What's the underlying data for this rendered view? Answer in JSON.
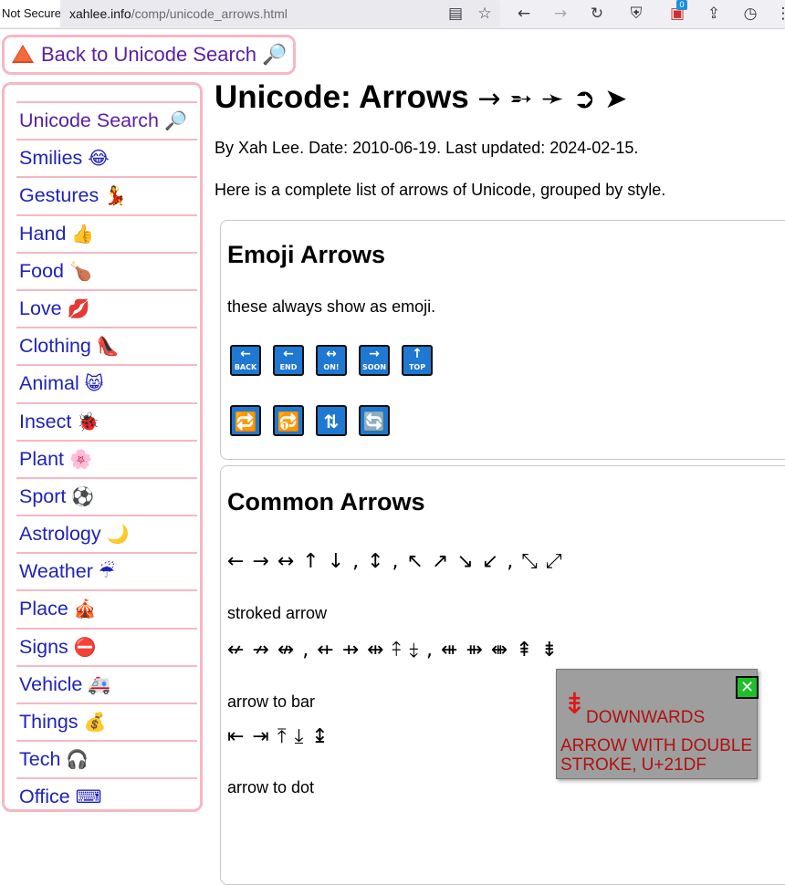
{
  "browser": {
    "security": "Not Secure",
    "url_host": "xahlee.info",
    "url_path": "/comp/unicode_arrows.html",
    "extension_badge": "0"
  },
  "back_button": {
    "label": "Back to Unicode Search"
  },
  "sidebar": {
    "items": [
      {
        "label": "Unicode Search",
        "icon": "🔎",
        "icon_name": "magnifier-icon"
      },
      {
        "label": "Smilies",
        "icon": "😂",
        "icon_name": "smiley-icon"
      },
      {
        "label": "Gestures",
        "icon": "💃",
        "icon_name": "dancer-icon"
      },
      {
        "label": "Hand",
        "icon": "👍",
        "icon_name": "thumbs-up-icon"
      },
      {
        "label": "Food",
        "icon": "🍗",
        "icon_name": "drumstick-icon"
      },
      {
        "label": "Love",
        "icon": "💋",
        "icon_name": "kiss-icon"
      },
      {
        "label": "Clothing",
        "icon": "👠",
        "icon_name": "high-heel-icon"
      },
      {
        "label": "Animal",
        "icon": "😸",
        "icon_name": "cat-icon"
      },
      {
        "label": "Insect",
        "icon": "🐞",
        "icon_name": "ladybug-icon"
      },
      {
        "label": "Plant",
        "icon": "🌸",
        "icon_name": "blossom-icon"
      },
      {
        "label": "Sport",
        "icon": "⚽",
        "icon_name": "soccer-ball-icon"
      },
      {
        "label": "Astrology",
        "icon": "🌙",
        "icon_name": "moon-icon"
      },
      {
        "label": "Weather",
        "icon": "☔",
        "icon_name": "umbrella-icon"
      },
      {
        "label": "Place",
        "icon": "🎪",
        "icon_name": "circus-tent-icon"
      },
      {
        "label": "Signs",
        "icon": "⛔",
        "icon_name": "no-entry-icon"
      },
      {
        "label": "Vehicle",
        "icon": "🚑",
        "icon_name": "ambulance-icon"
      },
      {
        "label": "Things",
        "icon": "💰",
        "icon_name": "money-bag-icon"
      },
      {
        "label": "Tech",
        "icon": "🎧",
        "icon_name": "headphone-icon"
      },
      {
        "label": "Office",
        "icon": "⌨",
        "icon_name": "keyboard-icon"
      }
    ]
  },
  "main": {
    "title_text": "Unicode: Arrows",
    "title_arrows": "→ ➵ ➛ ➲ ➤",
    "byline": "By Xah Lee. Date: 2010-06-19. Last updated: 2024-02-15.",
    "intro": "Here is a complete list of arrows of Unicode, grouped by style."
  },
  "emoji_section": {
    "heading": "Emoji Arrows",
    "note": "these always show as emoji.",
    "row1": [
      {
        "arrow": "←",
        "label": "BACK",
        "icon_name": "back-arrow-icon"
      },
      {
        "arrow": "←",
        "label": "END",
        "icon_name": "end-arrow-icon"
      },
      {
        "arrow": "↔",
        "label": "ON!",
        "icon_name": "on-arrow-icon"
      },
      {
        "arrow": "→",
        "label": "SOON",
        "icon_name": "soon-arrow-icon"
      },
      {
        "arrow": "↑",
        "label": "TOP",
        "icon_name": "top-arrow-icon"
      }
    ],
    "row2": [
      {
        "glyph": "🔁",
        "icon_name": "repeat-icon"
      },
      {
        "glyph": "🔂",
        "icon_name": "repeat-once-icon"
      },
      {
        "glyph": "⇅",
        "icon_name": "vertical-arrows-icon"
      },
      {
        "glyph": "🔄",
        "icon_name": "counterclockwise-arrows-icon"
      }
    ]
  },
  "common_section": {
    "heading": "Common Arrows",
    "line1": "← → ↔ ↑ ↓ , ↕ , ↖ ↗ ↘ ↙ , ⤡ ⤢",
    "stroked_label": "stroked arrow",
    "line2": "↚ ↛ ↮ , ⇷ ⇸ ⇹ ⤉ ⤈ , ⇺ ⇻ ⇼ ⇞ ⇟",
    "bar_label": "arrow to bar",
    "line3": "⇤ ⇥ ⤒ ⤓ ↨",
    "dot_label": "arrow to dot"
  },
  "popup": {
    "char": "⇟",
    "line1": "DOWNWARDS",
    "line2": "ARROW WITH DOUBLE STROKE, U+21DF",
    "close_symbol": "✕"
  }
}
